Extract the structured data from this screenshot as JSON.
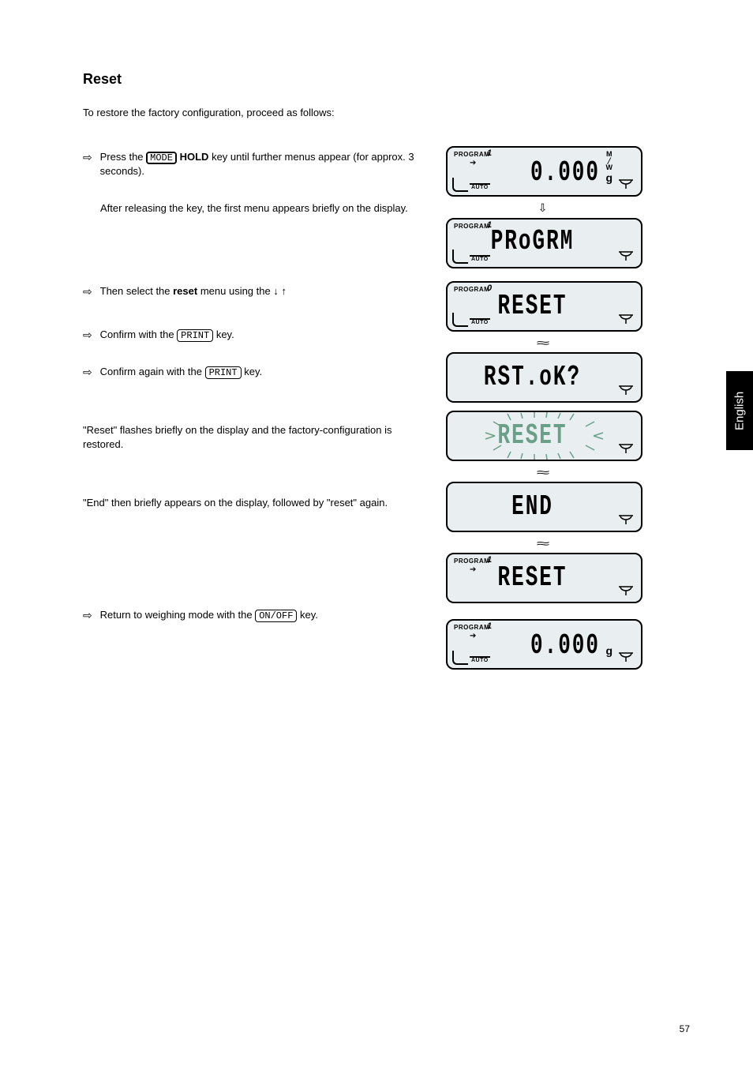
{
  "heading": "Reset",
  "intro": "To restore the factory configuration, proceed as follows:",
  "steps": {
    "a": {
      "text_before": "Press the ",
      "key": "MODE",
      "hold_keyword": " HOLD",
      "text_after": " key until further menus appear (for approx. 3 seconds).",
      "after_release": "After releasing the key, the first menu appears briefly on the display."
    },
    "b": {
      "text_before": "Then select the ",
      "label_bold": "reset",
      "text_after": " menu using the "
    },
    "c": {
      "text_before": "Confirm with the ",
      "key": "PRINT",
      "text_after": " key."
    },
    "d": {
      "text_before": "Confirm again with the ",
      "key": "PRINT",
      "text_after": " key."
    }
  },
  "notes": {
    "reset_flash": "\"Reset\" flashes briefly on the display and the factory-configuration is restored.",
    "end": "\"End\" then briefly appears on the display, followed by \"reset\" again.",
    "return": {
      "text_before": "Return to weighing mode with the ",
      "key": "ON/OFF",
      "text_after": " key."
    }
  },
  "lcd": {
    "program_label": "PROGRAM",
    "auto_label": "AUTO",
    "num_1": "1",
    "num_0": "0",
    "unit_g": "g",
    "mw_top": "M",
    "mw_bot": "W",
    "disp_zero": "0.000",
    "disp_progrm": "PRoGRM",
    "disp_reset": "RESET",
    "disp_rstok": "RST.oK?",
    "disp_end": "END"
  },
  "lang_tab": "English",
  "page_number": "57"
}
